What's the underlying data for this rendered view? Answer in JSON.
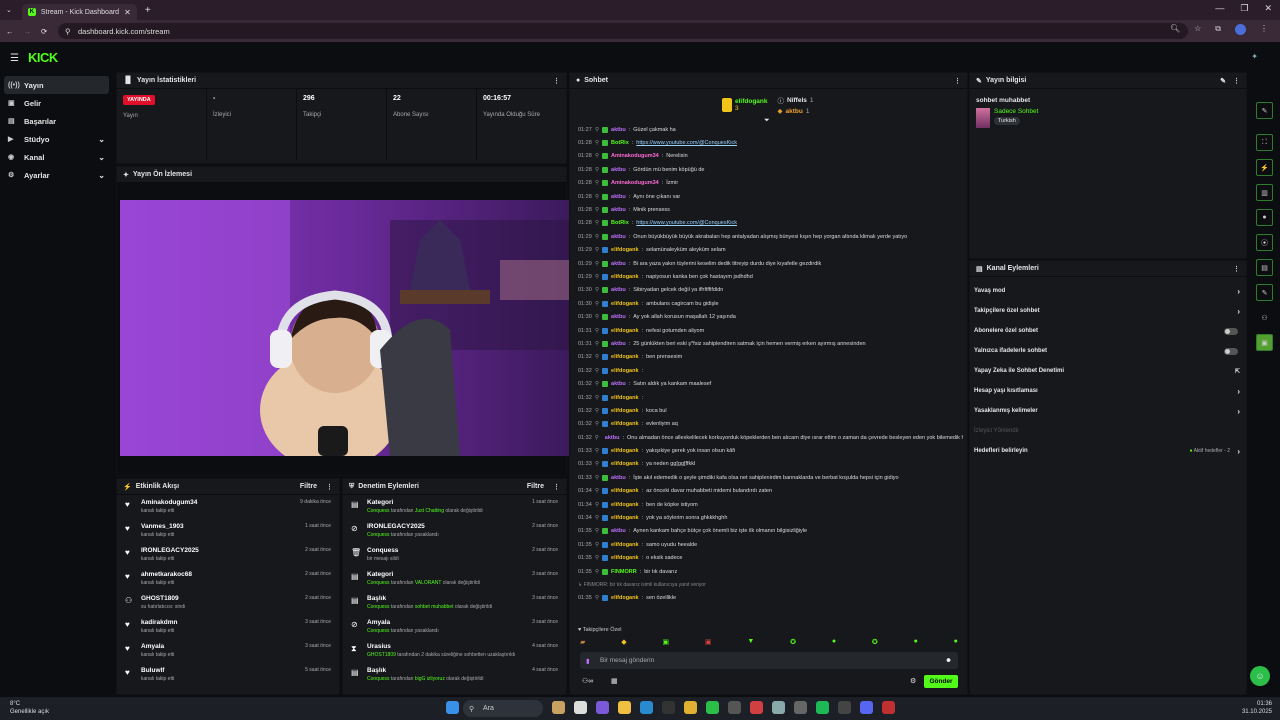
{
  "browser": {
    "tab_title": "Stream - Kick Dashboard",
    "url": "dashboard.kick.com/stream"
  },
  "app": {
    "logo": "KICK"
  },
  "sidebar": {
    "items": [
      {
        "label": "Yayın",
        "icon": "broadcast-icon"
      },
      {
        "label": "Gelir",
        "icon": "wallet-icon"
      },
      {
        "label": "Başarılar",
        "icon": "badge-icon"
      },
      {
        "label": "Stüdyo",
        "icon": "video-icon"
      },
      {
        "label": "Kanal",
        "icon": "user-icon"
      },
      {
        "label": "Ayarlar",
        "icon": "gear-icon"
      }
    ]
  },
  "stats": {
    "title": "Yayın İstatistikleri",
    "live_badge": "YAYINDA",
    "items": [
      {
        "label": "Yayın",
        "value": ""
      },
      {
        "label": "İzleyici",
        "value": "-"
      },
      {
        "label": "Takipçi",
        "value": "296"
      },
      {
        "label": "Abone Sayısı",
        "value": "22"
      },
      {
        "label": "Yayında Olduğu Süre",
        "value": "00:16:57"
      }
    ]
  },
  "preview": {
    "title": "Yayın Ön İzlemesi"
  },
  "activity": {
    "title": "Etkinlik Akışı",
    "filter": "Filtre",
    "items": [
      {
        "name": "Aminakodugum34",
        "sub": "kanalı takip etti",
        "time": "9 dakika önce"
      },
      {
        "name": "Vanmes_1903",
        "sub": "kanalı takip etti",
        "time": "1 saat önce"
      },
      {
        "name": "IRONLEGACY2025",
        "sub": "kanalı takip etti",
        "time": "2 saat önce"
      },
      {
        "name": "ahmetkarakoc68",
        "sub": "kanalı takip etti",
        "time": "2 saat önce"
      },
      {
        "name": "GHOST1809",
        "sub": "su hatırlatıcısı: sindi",
        "time": "2 saat önce"
      },
      {
        "name": "kadirakdmn",
        "sub": "kanalı takip etti",
        "time": "3 saat önce"
      },
      {
        "name": "Amyala",
        "sub": "kanalı takip etti",
        "time": "3 saat önce"
      },
      {
        "name": "Buluwlf",
        "sub": "kanalı takip etti",
        "time": "5 saat önce"
      }
    ]
  },
  "moderation": {
    "title": "Denetim Eylemleri",
    "filter": "Filtre",
    "items": [
      {
        "name": "Kategori",
        "actor": "Conquess",
        "sub_pre": " tarafından ",
        "hl": "Just Chatting",
        "sub_post": " olarak değiştirildi",
        "time": "1 saat önce"
      },
      {
        "name": "IRONLEGACY2025",
        "actor": "Conquess",
        "sub_pre": " tarafından yasaklandı",
        "hl": "",
        "sub_post": "",
        "time": "2 saat önce"
      },
      {
        "name": "Conquess",
        "actor": "",
        "sub_pre": "bir mesajı sildi",
        "hl": "",
        "sub_post": "",
        "time": "2 saat önce"
      },
      {
        "name": "Kategori",
        "actor": "Conquess",
        "sub_pre": " tarafından ",
        "hl": "VALORANT",
        "sub_post": " olarak değiştirildi",
        "time": "3 saat önce"
      },
      {
        "name": "Başlık",
        "actor": "Conquess",
        "sub_pre": " tarafından ",
        "hl": "sohbet muhabbet",
        "sub_post": " olarak değiştirildi",
        "time": "3 saat önce"
      },
      {
        "name": "Amyala",
        "actor": "Conquess",
        "sub_pre": " tarafından yasaklandı",
        "hl": "",
        "sub_post": "",
        "time": "3 saat önce"
      },
      {
        "name": "Urasius",
        "actor": "GHOST1809",
        "sub_pre": " tarafından 2 dakika süreliğine sohbetten uzaklaştırıldı",
        "hl": "",
        "sub_post": "",
        "time": "4 saat önce"
      },
      {
        "name": "Başlık",
        "actor": "Conquess",
        "sub_pre": " tarafından ",
        "hl": "bigG izliyoruz",
        "sub_post": " olarak değiştirildi",
        "time": "4 saat önce"
      }
    ]
  },
  "chat": {
    "title": "Sohbet",
    "pinned": [
      {
        "name": "elifdogank",
        "count": "3"
      },
      {
        "name": "Niffels",
        "count": "1"
      },
      {
        "name": "aktbu",
        "count": "1"
      }
    ],
    "lines": [
      {
        "t": "01:27",
        "u": "aktbu",
        "c": "p",
        "m": "Güzel çakmak ha"
      },
      {
        "t": "01:28",
        "u": "BotRix",
        "c": "g",
        "m": "https://www.youtube.com/@ConquesKick",
        "link": true
      },
      {
        "t": "01:28",
        "u": "Aminakodugum34",
        "c": "pk",
        "m": "Nerelisin"
      },
      {
        "t": "01:28",
        "u": "aktbu",
        "c": "p",
        "m": "Gördün mü benim köpüğü de"
      },
      {
        "t": "01:28",
        "u": "Aminakodugum34",
        "c": "pk",
        "m": "İzmir"
      },
      {
        "t": "01:28",
        "u": "aktbu",
        "c": "p",
        "m": "Aynı öne çıkanı var"
      },
      {
        "t": "01:28",
        "u": "aktbu",
        "c": "p",
        "m": "Minik prensess"
      },
      {
        "t": "01:28",
        "u": "BotRix",
        "c": "g",
        "m": "https://www.youtube.com/@ConquesKick",
        "link": true
      },
      {
        "t": "01:29",
        "u": "aktbu",
        "c": "p",
        "m": "Onun büyükbüyük büyük akrabaları hep antalyadan alışmış bünyesi kışın hep yorgan altında klimalı yerde yatıyo"
      },
      {
        "t": "01:29",
        "u": "elifdogank",
        "c": "y",
        "m": "selamünaleyküm aleyküm selam"
      },
      {
        "t": "01:29",
        "u": "aktbu",
        "c": "p",
        "m": "Bi ara yaza yakın tüylerini keselim dedik titreyip durdu diye kıyafetle gezdirdik"
      },
      {
        "t": "01:29",
        "u": "elifdogank",
        "c": "y",
        "m": "napiyosun kanka ben çok hastayım jsdhdhd"
      },
      {
        "t": "01:30",
        "u": "aktbu",
        "c": "p",
        "m": "Sibiryadan gelcek değil ya ifhfiffifdidn"
      },
      {
        "t": "01:30",
        "u": "elifdogank",
        "c": "y",
        "m": "ambulans cagircam bu gidişle"
      },
      {
        "t": "01:30",
        "u": "aktbu",
        "c": "p",
        "m": "Ay yok allah korusun maşallah 12 yaşında"
      },
      {
        "t": "01:31",
        "u": "elifdogank",
        "c": "y",
        "m": "nefesi gotumden aliyom"
      },
      {
        "t": "01:31",
        "u": "aktbu",
        "c": "p",
        "m": "25 günlükten beri eski ş*fsiz sahiplendiren satmak için hemen vermiş erken ayırmış annesinden"
      },
      {
        "t": "01:32",
        "u": "elifdogank",
        "c": "y",
        "m": "ben prensesim"
      },
      {
        "t": "01:32",
        "u": "elifdogank",
        "c": "y",
        "m": ""
      },
      {
        "t": "01:32",
        "u": "aktbu",
        "c": "p",
        "m": "Satın aldık ya kankam maalesef"
      },
      {
        "t": "01:32",
        "u": "elifdogank",
        "c": "y",
        "m": ""
      },
      {
        "t": "01:32",
        "u": "elifdogank",
        "c": "y",
        "m": "koca bul"
      },
      {
        "t": "01:32",
        "u": "elifdogank",
        "c": "y",
        "m": "evlenliyim aq"
      },
      {
        "t": "01:32",
        "u": "aktbu",
        "c": "p",
        "m": "Onu almadan önce allexkelilecek korkuyorduk köpeklerden ben alıcam diye ısrar ettim o zaman da çevrede besleyen eden yok bilemedik hiç satın almış olduk"
      },
      {
        "t": "01:33",
        "u": "elifdogank",
        "c": "y",
        "m": "yakışıkiye gerek yok insan olsun kâfi"
      },
      {
        "t": "01:33",
        "u": "elifdogank",
        "c": "y",
        "m": "ya neden gg[gg[ffkkl"
      },
      {
        "t": "01:33",
        "u": "aktbu",
        "c": "p",
        "m": "İşte akıl edemedik o şeyle şimdiki kafa olsa net sahiplenirdim bannaklarda ve berbat koşulda hepsi için gidiyo"
      },
      {
        "t": "01:34",
        "u": "elifdogank",
        "c": "y",
        "m": "az önceki davar muhabbeti midemi bulandırdı zaten"
      },
      {
        "t": "01:34",
        "u": "elifdogank",
        "c": "y",
        "m": "ben de köpke istiyom"
      },
      {
        "t": "01:34",
        "u": "elifdogank",
        "c": "y",
        "m": "yok ya söylerim sonra ghkkkhghh"
      },
      {
        "t": "01:35",
        "u": "aktbu",
        "c": "p",
        "m": "Aynen kankam bahçe bütçe çok önemli biz işte ilk olmanın bilgisizliğiyle"
      },
      {
        "t": "01:35",
        "u": "elifdogank",
        "c": "y",
        "m": "samo uyudu heealde"
      },
      {
        "t": "01:35",
        "u": "elifdogank",
        "c": "y",
        "m": "o eksik sadece"
      },
      {
        "t": "01:35",
        "u": "FINMORR",
        "c": "g",
        "m": "bir tık davarız"
      },
      {
        "t": "",
        "u": "FINMORR",
        "c": "muted",
        "m": "bir tık davarız isimli kullanıcıya yanıt veriyor"
      },
      {
        "t": "01:35",
        "u": "elifdogank",
        "c": "y",
        "m": "sen özellikle"
      }
    ],
    "followers_only": "Takipçilere Özel",
    "input_placeholder": "Bir mesaj gönderin",
    "send_label": "Gönder"
  },
  "stream_info": {
    "title": "Yayın bilgisi",
    "stream_title": "sohbet muhabbet",
    "category": "Sadece Sohbet",
    "tag": "Turkish"
  },
  "channel_actions": {
    "title": "Kanal Eylemleri",
    "items": [
      {
        "label": "Yavaş mod",
        "kind": "arrow"
      },
      {
        "label": "Takipçilere özel sohbet",
        "kind": "arrow"
      },
      {
        "label": "Abonelere özel sohbet",
        "kind": "toggle"
      },
      {
        "label": "Yalnızca ifadelerle sohbet",
        "kind": "toggle"
      },
      {
        "label": "Yapay Zeka ile Sohbet Denetimi",
        "kind": "ext"
      },
      {
        "label": "Hesap yaşı kısıtlaması",
        "kind": "arrow"
      },
      {
        "label": "Yasaklanmış kelimeler",
        "kind": "arrow"
      },
      {
        "label": "İzleyici Yönlendir",
        "kind": "muted"
      },
      {
        "label": "Hedefleri belirleyin",
        "kind": "goal",
        "extra": "Aktif hedefler - 2"
      }
    ]
  },
  "taskbar": {
    "weather_temp": "8°C",
    "weather_desc": "Genellikle açık",
    "search": "Ara",
    "time": "01:36",
    "date": "31.10.2025"
  }
}
